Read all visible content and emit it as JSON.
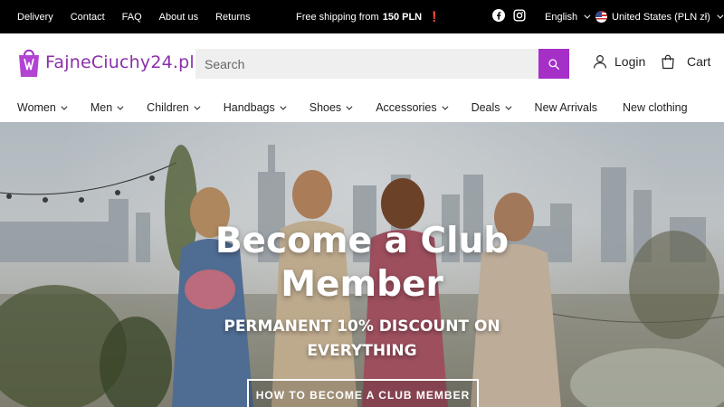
{
  "topbar": {
    "links": [
      "Delivery",
      "Contact",
      "FAQ",
      "About us",
      "Returns"
    ],
    "promo_prefix": "Free shipping from",
    "promo_amount": "150 PLN",
    "promo_mark": "❗",
    "language": "English",
    "region": "United States (PLN zł)"
  },
  "header": {
    "logo_text": "FajneCiuchy24.pl",
    "search_placeholder": "Search",
    "login_label": "Login",
    "cart_label": "Cart"
  },
  "nav": {
    "items": [
      {
        "label": "Women",
        "dropdown": true
      },
      {
        "label": "Men",
        "dropdown": true
      },
      {
        "label": "Children",
        "dropdown": true
      },
      {
        "label": "Handbags",
        "dropdown": true
      },
      {
        "label": "Shoes",
        "dropdown": true
      },
      {
        "label": "Accessories",
        "dropdown": true
      },
      {
        "label": "Deals",
        "dropdown": true
      },
      {
        "label": "New Arrivals",
        "dropdown": false
      },
      {
        "label": "New clothing",
        "dropdown": false
      }
    ]
  },
  "hero": {
    "title_line1": "Become a Club",
    "title_line2": "Member",
    "subtitle_line1": "PERMANENT 10% DISCOUNT ON",
    "subtitle_line2": "EVERYTHING",
    "cta_label": "HOW TO BECOME A CLUB MEMBER"
  },
  "colors": {
    "accent": "#a52fc7",
    "brand": "#8b2fa8",
    "topbar_bg": "#000000",
    "alert": "#e02b2b"
  },
  "icons": [
    "facebook-icon",
    "instagram-icon",
    "us-flag-icon",
    "search-icon",
    "user-icon",
    "shopping-bag-icon",
    "chevron-down-icon"
  ]
}
